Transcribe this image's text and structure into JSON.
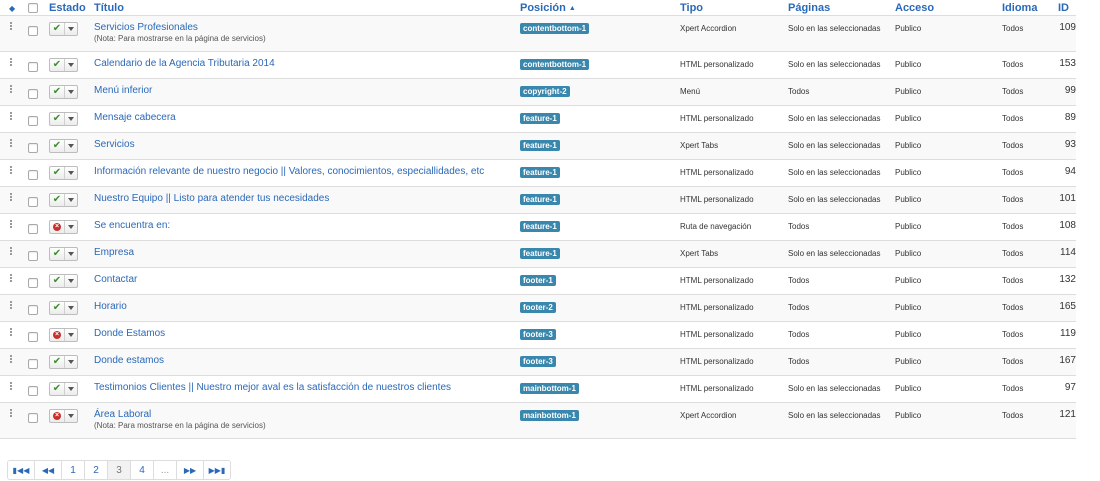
{
  "headers": {
    "estado": "Estado",
    "titulo": "Título",
    "posicion": "Posición",
    "tipo": "Tipo",
    "paginas": "Páginas",
    "acceso": "Acceso",
    "idioma": "Idioma",
    "id": "ID"
  },
  "rows": [
    {
      "status": "published",
      "title": "Servicios Profesionales",
      "note": "(Nota: Para mostrarse en la página de servicios)",
      "position": "contentbottom-1",
      "type": "Xpert Accordion",
      "pages": "Solo en las seleccionadas",
      "access": "Publico",
      "language": "Todos",
      "id": "109"
    },
    {
      "status": "published",
      "title": "Calendario de la Agencia Tributaria 2014",
      "note": "",
      "position": "contentbottom-1",
      "type": "HTML personalizado",
      "pages": "Solo en las seleccionadas",
      "access": "Publico",
      "language": "Todos",
      "id": "153"
    },
    {
      "status": "published",
      "title": "Menú inferior",
      "note": "",
      "position": "copyright-2",
      "type": "Menú",
      "pages": "Todos",
      "access": "Publico",
      "language": "Todos",
      "id": "99"
    },
    {
      "status": "published",
      "title": "Mensaje cabecera",
      "note": "",
      "position": "feature-1",
      "type": "HTML personalizado",
      "pages": "Solo en las seleccionadas",
      "access": "Publico",
      "language": "Todos",
      "id": "89"
    },
    {
      "status": "published",
      "title": "Servicios",
      "note": "",
      "position": "feature-1",
      "type": "Xpert Tabs",
      "pages": "Solo en las seleccionadas",
      "access": "Publico",
      "language": "Todos",
      "id": "93"
    },
    {
      "status": "published",
      "title": "Información relevante de nuestro negocio || Valores, conocimientos, especiallidades, etc",
      "note": "",
      "position": "feature-1",
      "type": "HTML personalizado",
      "pages": "Solo en las seleccionadas",
      "access": "Publico",
      "language": "Todos",
      "id": "94"
    },
    {
      "status": "published",
      "title": "Nuestro Equipo || Listo para atender tus necesidades",
      "note": "",
      "position": "feature-1",
      "type": "HTML personalizado",
      "pages": "Solo en las seleccionadas",
      "access": "Publico",
      "language": "Todos",
      "id": "101"
    },
    {
      "status": "unpublished",
      "title": "Se encuentra en:",
      "note": "",
      "position": "feature-1",
      "type": "Ruta de navegación",
      "pages": "Todos",
      "access": "Publico",
      "language": "Todos",
      "id": "108"
    },
    {
      "status": "published",
      "title": "Empresa",
      "note": "",
      "position": "feature-1",
      "type": "Xpert Tabs",
      "pages": "Solo en las seleccionadas",
      "access": "Publico",
      "language": "Todos",
      "id": "114"
    },
    {
      "status": "published",
      "title": "Contactar",
      "note": "",
      "position": "footer-1",
      "type": "HTML personalizado",
      "pages": "Todos",
      "access": "Publico",
      "language": "Todos",
      "id": "132"
    },
    {
      "status": "published",
      "title": "Horario",
      "note": "",
      "position": "footer-2",
      "type": "HTML personalizado",
      "pages": "Todos",
      "access": "Publico",
      "language": "Todos",
      "id": "165"
    },
    {
      "status": "unpublished",
      "title": "Donde Estamos",
      "note": "",
      "position": "footer-3",
      "type": "HTML personalizado",
      "pages": "Todos",
      "access": "Publico",
      "language": "Todos",
      "id": "119"
    },
    {
      "status": "published",
      "title": "Donde estamos",
      "note": "",
      "position": "footer-3",
      "type": "HTML personalizado",
      "pages": "Todos",
      "access": "Publico",
      "language": "Todos",
      "id": "167"
    },
    {
      "status": "published",
      "title": "Testimonios Clientes || Nuestro mejor aval es la satisfacción de nuestros clientes",
      "note": "",
      "position": "mainbottom-1",
      "type": "HTML personalizado",
      "pages": "Solo en las seleccionadas",
      "access": "Publico",
      "language": "Todos",
      "id": "97"
    },
    {
      "status": "unpublished",
      "title": "Área Laboral",
      "note": "(Nota: Para mostrarse en la página de servicios)",
      "position": "mainbottom-1",
      "type": "Xpert Accordion",
      "pages": "Solo en las seleccionadas",
      "access": "Publico",
      "language": "Todos",
      "id": "121"
    }
  ],
  "pagination": {
    "pages": [
      "1",
      "2",
      "3",
      "4",
      "..."
    ],
    "active": "3"
  },
  "colors": {
    "link": "#2a69b8",
    "badge": "#3a87ad",
    "published": "#3d8f2c",
    "unpublished": "#c9302c"
  }
}
